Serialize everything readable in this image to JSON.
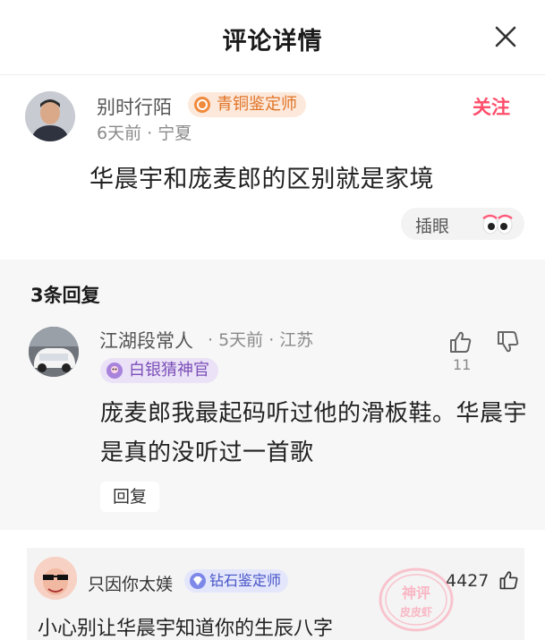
{
  "header": {
    "title": "评论详情"
  },
  "main_comment": {
    "username": "别时行陌",
    "badge": "青铜鉴定师",
    "follow_label": "关注",
    "time": "6天前",
    "location": "宁夏",
    "meta": "6天前 · 宁夏",
    "text": "华晨宇和庞麦郎的区别就是家境",
    "sticker_label": "插眼"
  },
  "replies": {
    "count_label": "3条回复",
    "items": [
      {
        "username": "江湖段常人",
        "meta": "· 5天前 · 江苏",
        "badge": "白银猜神官",
        "likes": "11",
        "text": "庞麦郎我最起码听过他的滑板鞋。华晨宇是真的没听过一首歌",
        "reply_label": "回复"
      }
    ]
  },
  "hot_comment": {
    "username": "只因你太媄",
    "badge": "钻石鉴定师",
    "likes": "4427",
    "text": "小心别让华晨宇知道你的生辰八字",
    "watermark_top": "神评",
    "watermark_bottom": "皮皮虾"
  },
  "colors": {
    "accent_pink": "#ff4d6a",
    "bronze_badge_bg": "#fde9dc",
    "bronze_badge_text": "#e07326",
    "silver_badge_bg": "#ebe2f7",
    "silver_badge_text": "#7b4fb8",
    "diamond_badge_bg": "#e4e7fb",
    "diamond_badge_text": "#4653c7"
  }
}
